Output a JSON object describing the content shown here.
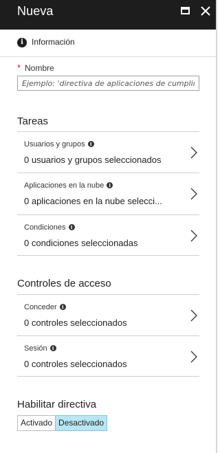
{
  "panel": {
    "title": "Nueva"
  },
  "toolbar": {
    "info_label": "Información"
  },
  "name_field": {
    "label": "Nombre",
    "required_marker": "*",
    "placeholder": "Ejemplo: 'directiva de aplicaciones de cumplimiento del dispositivo'"
  },
  "tasks": {
    "title": "Tareas",
    "items": [
      {
        "label": "Usuarios y grupos",
        "value": "0 usuarios y grupos seleccionados"
      },
      {
        "label": "Aplicaciones en la nube",
        "value": "0 aplicaciones en la nube selecci..."
      },
      {
        "label": "Condiciones",
        "value": "0 condiciones seleccionadas"
      }
    ]
  },
  "access_controls": {
    "title": "Controles de acceso",
    "items": [
      {
        "label": "Conceder",
        "value": "0 controles seleccionados"
      },
      {
        "label": "Sesión",
        "value": "0 controles seleccionados"
      }
    ]
  },
  "enable_policy": {
    "title": "Habilitar directiva",
    "options": [
      "Activado",
      "Desactivado"
    ],
    "selected": "Desactivado"
  },
  "icons": {
    "info": "i",
    "colors": {
      "titlebar": "#1d1d1d",
      "required": "#e81123",
      "toggle_selected": "#b9e6f4"
    }
  }
}
